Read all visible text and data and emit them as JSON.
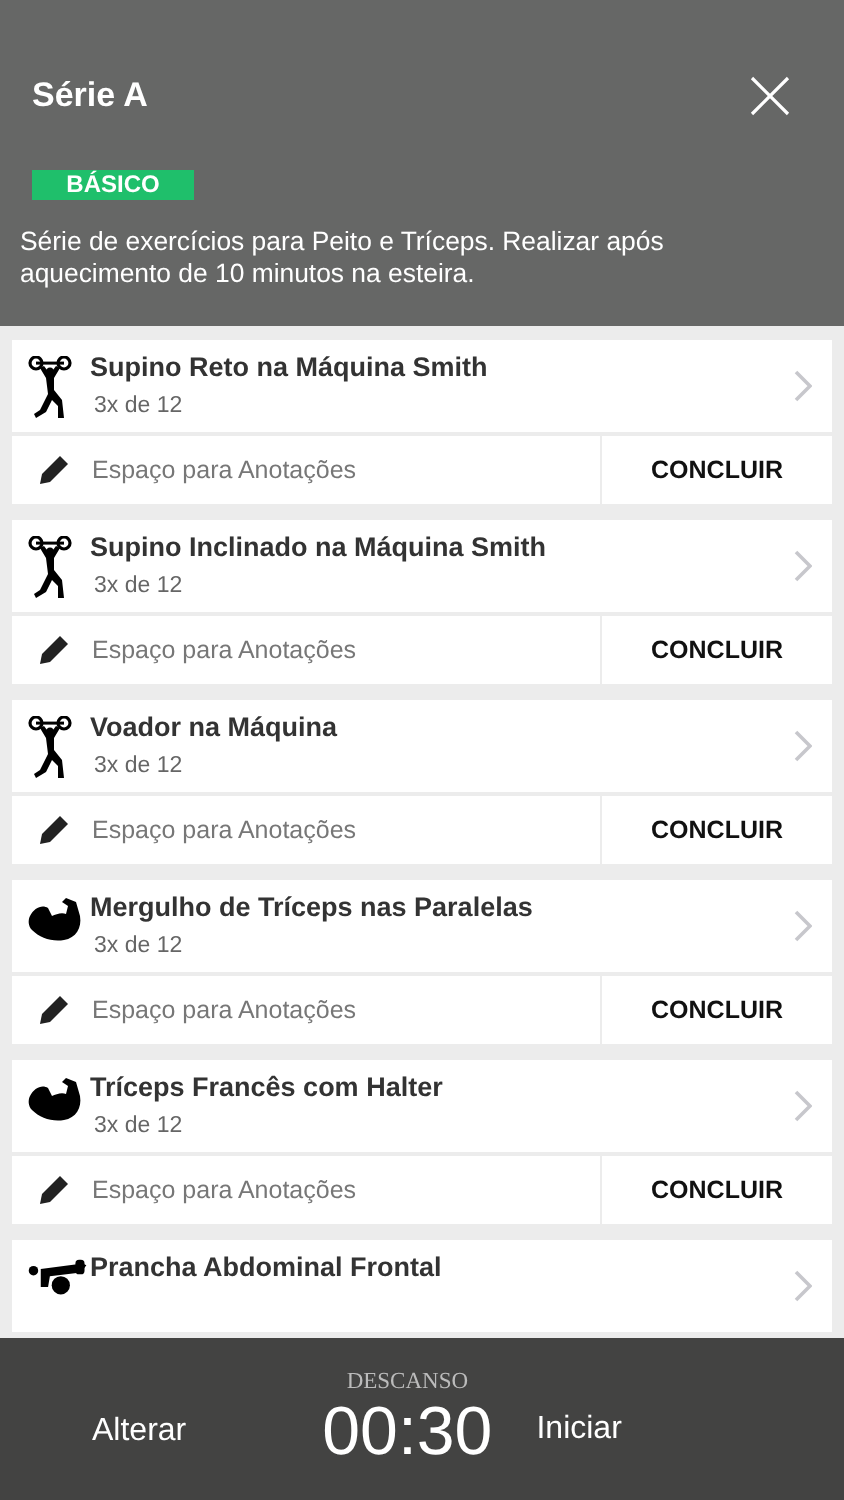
{
  "header": {
    "title": "Série A",
    "level_badge": "BÁSICO",
    "description": "Série de exercícios para Peito e Tríceps. Realizar após aquecimento de 10 minutos na esteira."
  },
  "exercises": [
    {
      "kind": "weightlifter",
      "name": "Supino Reto na Máquina Smith",
      "sets": "3x de 12",
      "notes_placeholder": "Espaço para Anotações",
      "action": "CONCLUIR"
    },
    {
      "kind": "weightlifter",
      "name": "Supino Inclinado na Máquina Smith",
      "sets": "3x de 12",
      "notes_placeholder": "Espaço para Anotações",
      "action": "CONCLUIR"
    },
    {
      "kind": "weightlifter",
      "name": "Voador na Máquina",
      "sets": "3x de 12",
      "notes_placeholder": "Espaço para Anotações",
      "action": "CONCLUIR"
    },
    {
      "kind": "arm",
      "name": "Mergulho de Tríceps nas Paralelas",
      "sets": "3x de 12",
      "notes_placeholder": "Espaço para Anotações",
      "action": "CONCLUIR"
    },
    {
      "kind": "arm",
      "name": "Tríceps Francês com Halter",
      "sets": "3x de 12",
      "notes_placeholder": "Espaço para Anotações",
      "action": "CONCLUIR"
    },
    {
      "kind": "plank",
      "name": "Prancha Abdominal Frontal"
    }
  ],
  "rest_bar": {
    "left_button": "Alterar",
    "label": "DESCANSO",
    "time": "00:30",
    "right_button": "Iniciar"
  }
}
